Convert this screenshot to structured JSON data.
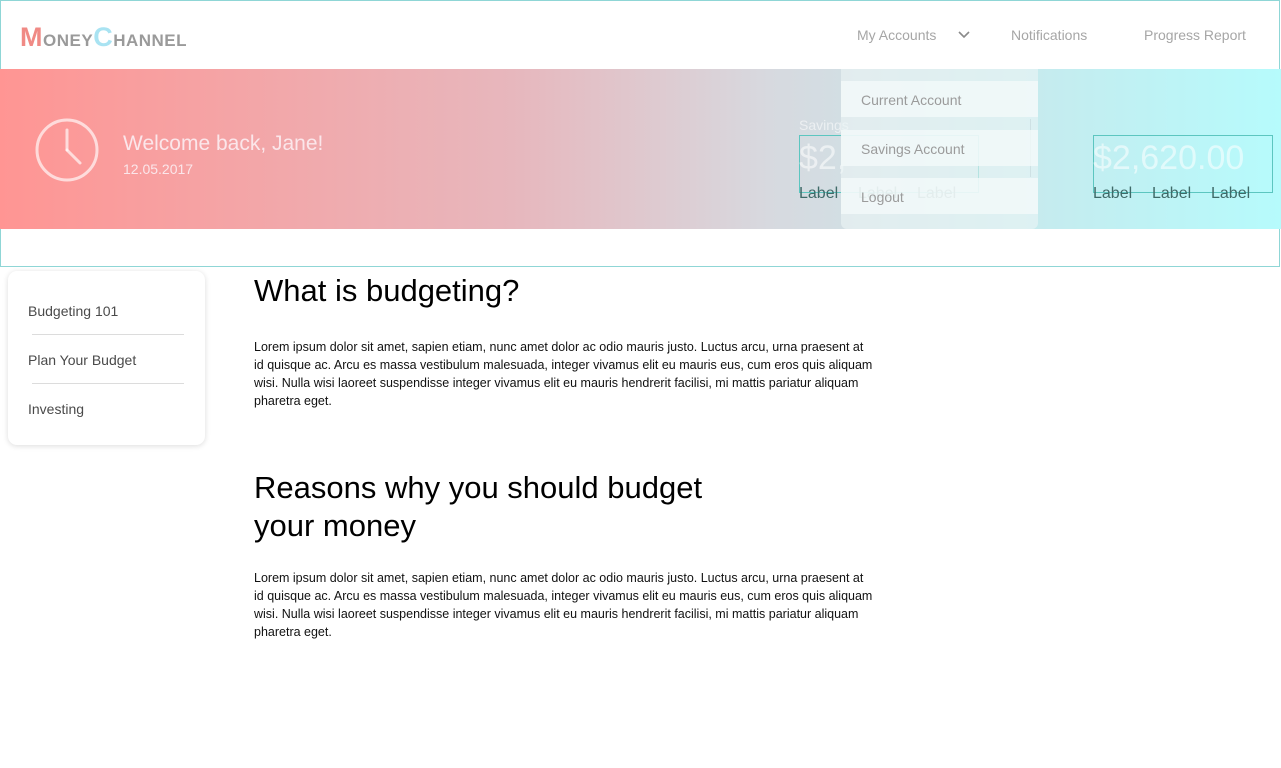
{
  "app": {
    "logo": {
      "m": "M",
      "oney": "ONEY",
      "c": "C",
      "hannel": "HANNEL"
    }
  },
  "nav": {
    "my_accounts": "My Accounts",
    "notifications": "Notifications",
    "progress_report": "Progress Report"
  },
  "banner": {
    "welcome": "Welcome back, Jane!",
    "date": "12.05.2017",
    "savings_label": "Savings",
    "savings_amount": "$2,",
    "current_amount": "$2,620.00",
    "sub_labels": [
      "Label",
      "Label",
      "Label"
    ]
  },
  "dropdown": {
    "items": [
      "Current Account",
      "Savings Account",
      "Logout"
    ]
  },
  "sidebar": {
    "items": [
      "Budgeting 101",
      "Plan Your Budget",
      "Investing"
    ]
  },
  "content": {
    "heading1": "What is budgeting?",
    "para1": "Lorem ipsum dolor sit amet, sapien etiam, nunc amet dolor ac odio mauris justo. Luctus arcu, urna praesent at id quisque ac. Arcu es massa vestibulum malesuada, integer vivamus elit eu mauris eus, cum eros quis aliquam wisi. Nulla wisi laoreet suspendisse integer vivamus elit eu mauris hendrerit facilisi, mi mattis pariatur aliquam pharetra eget.",
    "heading2": "Reasons why you should budget your money",
    "para2": "Lorem ipsum dolor sit amet, sapien etiam, nunc amet dolor ac odio mauris justo. Luctus arcu, urna praesent at id quisque ac. Arcu es massa vestibulum malesuada, integer vivamus elit eu mauris eus, cum eros quis aliquam wisi. Nulla wisi laoreet suspendisse integer vivamus elit eu mauris hendrerit facilisi, mi mattis pariatur aliquam pharetra eget."
  },
  "icons": {
    "clock": "clock-icon",
    "chevron": "chevron-down-icon"
  },
  "colors": {
    "brand_coral": "#f08a85",
    "brand_cyan": "#a9e3f2",
    "gradient_start": "#ff9593",
    "gradient_end": "#b6fbfc"
  }
}
